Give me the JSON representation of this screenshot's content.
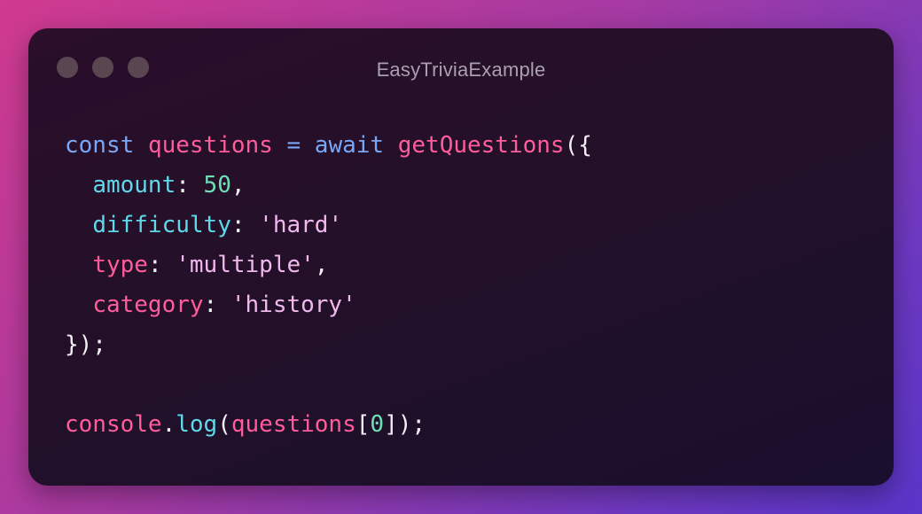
{
  "window": {
    "title": "EasyTriviaExample"
  },
  "code": {
    "line1": {
      "kw_const": "const",
      "var_questions": "questions",
      "op_eq": "=",
      "kw_await": "await",
      "fn_name": "getQuestions",
      "open": "({"
    },
    "line2": {
      "indent": "  ",
      "prop": "amount",
      "colon": ": ",
      "value": "50",
      "comma": ","
    },
    "line3": {
      "indent": "  ",
      "prop": "difficulty",
      "colon": ": ",
      "value": "'hard'"
    },
    "line4": {
      "indent": "  ",
      "prop": "type",
      "colon": ": ",
      "value": "'multiple'",
      "comma": ","
    },
    "line5": {
      "indent": "  ",
      "prop": "category",
      "colon": ": ",
      "value": "'history'"
    },
    "line6": {
      "close": "});"
    },
    "line8": {
      "obj": "console",
      "dot": ".",
      "method": "log",
      "open": "(",
      "arg": "questions",
      "bracket_open": "[",
      "index": "0",
      "bracket_close": "]",
      "close": ");"
    }
  },
  "colors": {
    "keyword": "#7aa7f5",
    "identifier": "#ff5c9a",
    "property": "#5fd8ea",
    "number": "#6fe0b6",
    "string": "#f1b8ee",
    "punctuation": "#f2f0f6"
  }
}
